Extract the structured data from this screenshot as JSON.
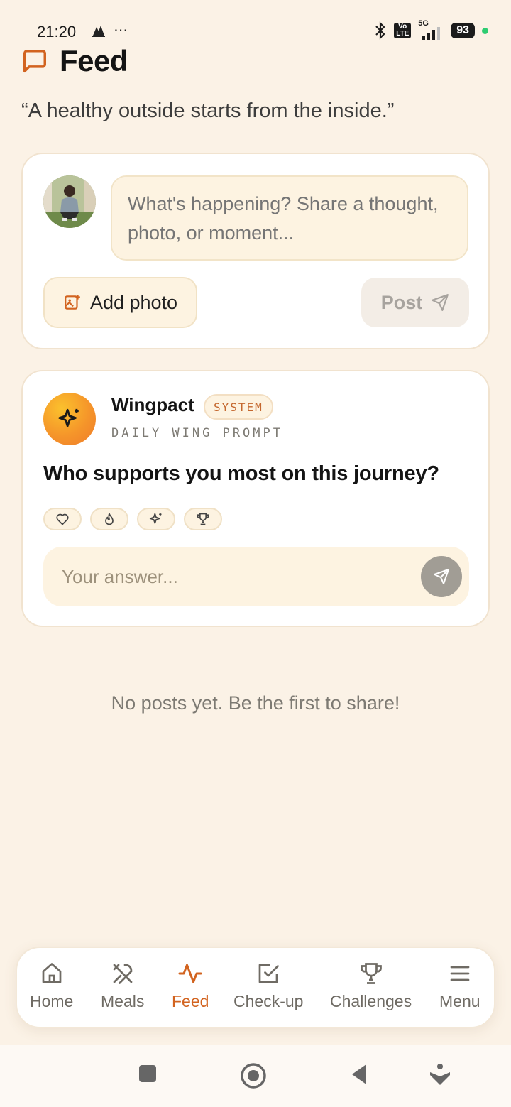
{
  "status_bar": {
    "time": "21:20",
    "extra_icons": "⋯",
    "network": "5G",
    "volte": "Vo LTE",
    "battery": "93"
  },
  "header": {
    "title": "Feed",
    "icon": "message-square-icon",
    "tagline": "“A healthy outside starts from the inside.”"
  },
  "composer": {
    "placeholder": "What's happening? Share a thought, photo, or moment...",
    "add_photo_label": "Add photo",
    "post_label": "Post"
  },
  "prompt_card": {
    "author": "Wingpact",
    "badge": "SYSTEM",
    "subtitle": "DAILY WING PROMPT",
    "question": "Who supports you most on this journey?",
    "reactions": [
      "heart-icon",
      "flame-icon",
      "sparkles-icon",
      "trophy-icon"
    ],
    "answer_placeholder": "Your answer..."
  },
  "empty_state": "No posts yet. Be the first to share!",
  "bottom_nav": {
    "items": [
      {
        "label": "Home",
        "icon": "home-icon"
      },
      {
        "label": "Meals",
        "icon": "utensils-icon"
      },
      {
        "label": "Feed",
        "icon": "activity-icon",
        "active": true
      },
      {
        "label": "Check-up",
        "icon": "check-square-icon"
      },
      {
        "label": "Challenges",
        "icon": "trophy-icon"
      },
      {
        "label": "Menu",
        "icon": "menu-icon"
      }
    ]
  },
  "colors": {
    "background": "#fbf2e6",
    "accent": "#d2631f",
    "card": "#ffffff"
  }
}
